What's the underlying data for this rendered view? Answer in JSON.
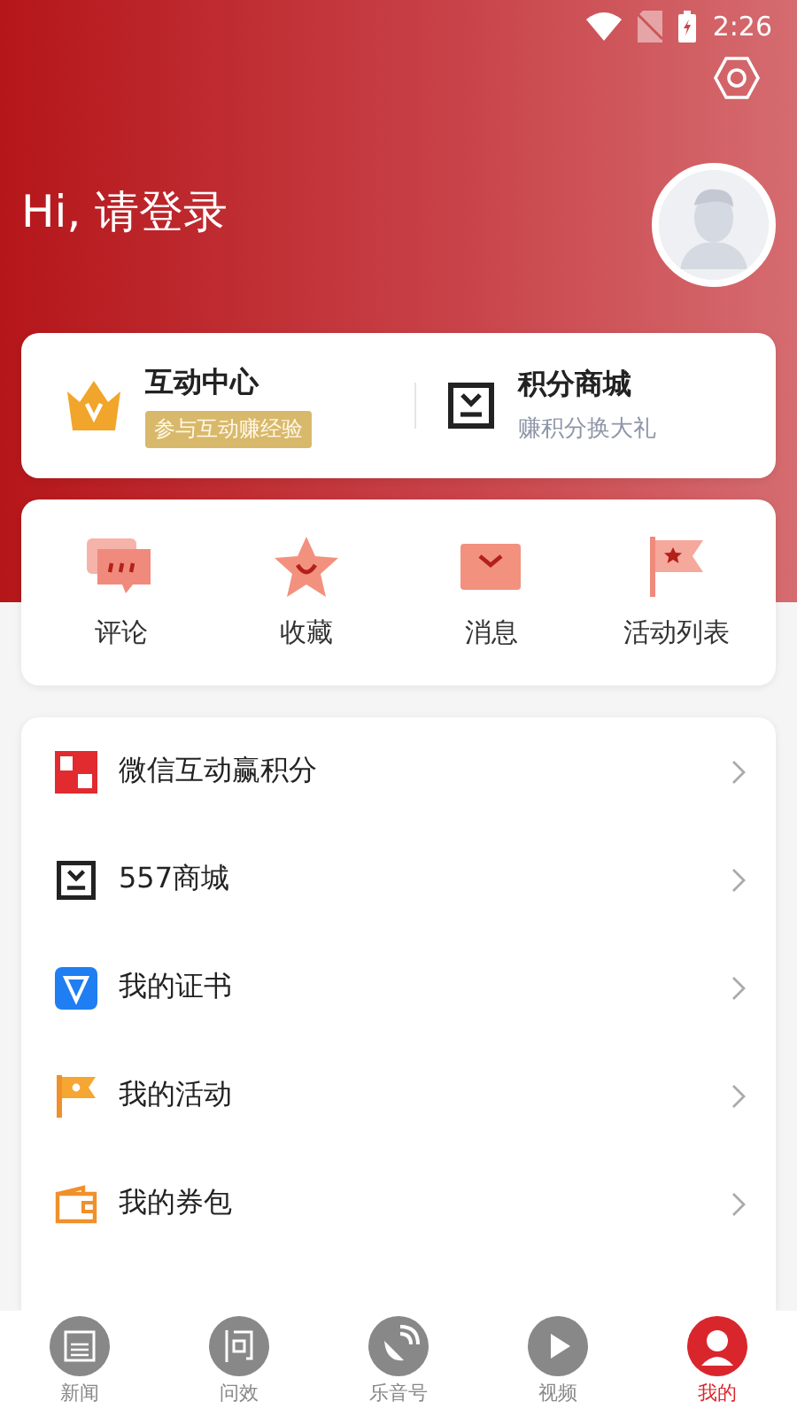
{
  "status_bar": {
    "time": "2:26"
  },
  "header": {
    "greeting": "Hi, 请登录"
  },
  "points_card": [
    {
      "kind": "crown",
      "title": "互动中心",
      "badge": "参与互动赚经验"
    },
    {
      "kind": "shop",
      "title": "积分商城",
      "subtitle": "赚积分换大礼"
    }
  ],
  "shortcuts": [
    {
      "kind": "comment",
      "label": "评论"
    },
    {
      "kind": "star",
      "label": "收藏"
    },
    {
      "kind": "mail",
      "label": "消息"
    },
    {
      "kind": "flag",
      "label": "活动列表"
    }
  ],
  "menu": [
    {
      "kind": "wechat",
      "label": "微信互动赢积分"
    },
    {
      "kind": "shop",
      "label": "557商城"
    },
    {
      "kind": "cert",
      "label": "我的证书"
    },
    {
      "kind": "flag",
      "label": "我的活动"
    },
    {
      "kind": "wallet",
      "label": "我的券包"
    }
  ],
  "tab_bar": [
    {
      "kind": "news",
      "label": "新闻",
      "selected": false
    },
    {
      "kind": "ask",
      "label": "问效",
      "selected": false
    },
    {
      "kind": "radio",
      "label": "乐音号",
      "selected": false
    },
    {
      "kind": "video",
      "label": "视频",
      "selected": false
    },
    {
      "kind": "me",
      "label": "我的",
      "selected": true
    }
  ]
}
